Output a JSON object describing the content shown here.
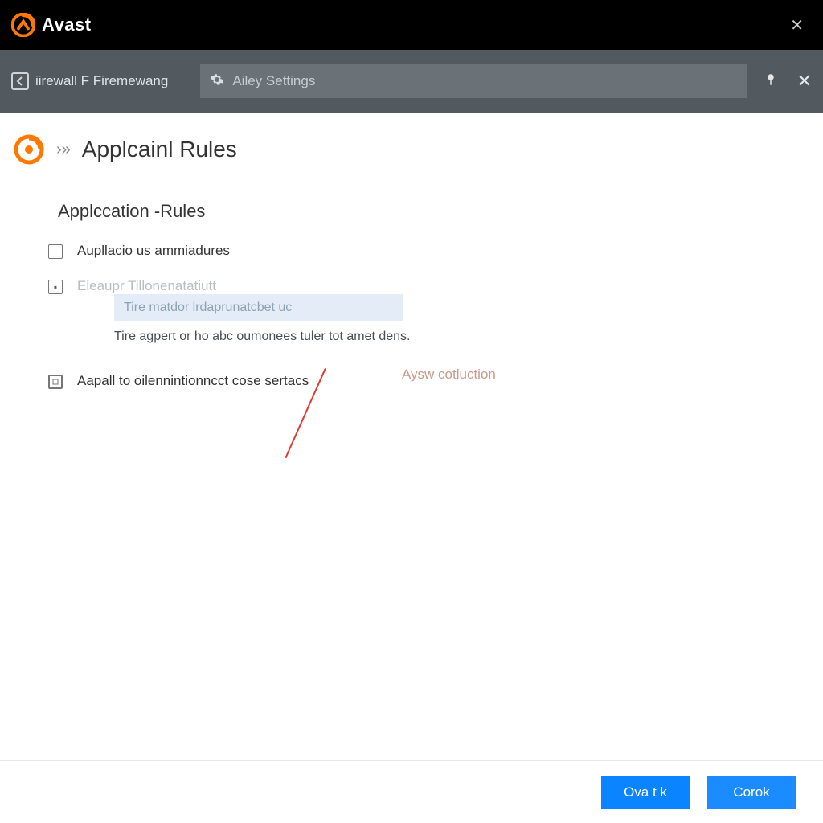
{
  "titlebar": {
    "brand": "Avast"
  },
  "toolbar": {
    "breadcrumb": "iirewall F Firemewang",
    "search_placeholder": "Ailey Settings"
  },
  "page": {
    "title": "Applcainl Rules",
    "section_title": "Applccation -Rules",
    "annotation": "Aysw cotluction",
    "options": {
      "opt1_label": "Aupllacio us ammiadures",
      "opt2_label": "Eleaupr Tillonenatatiutt",
      "highlight_text": "Tire matdor lrdaprunatcbet uc",
      "description": "Tire agpert or ho abc oumonees tuler tot amet dens.",
      "opt3_label": "Aapall to oilennintionncct cose sertacs"
    }
  },
  "footer": {
    "ok_label": "Ova t k",
    "cancel_label": "Corok"
  }
}
